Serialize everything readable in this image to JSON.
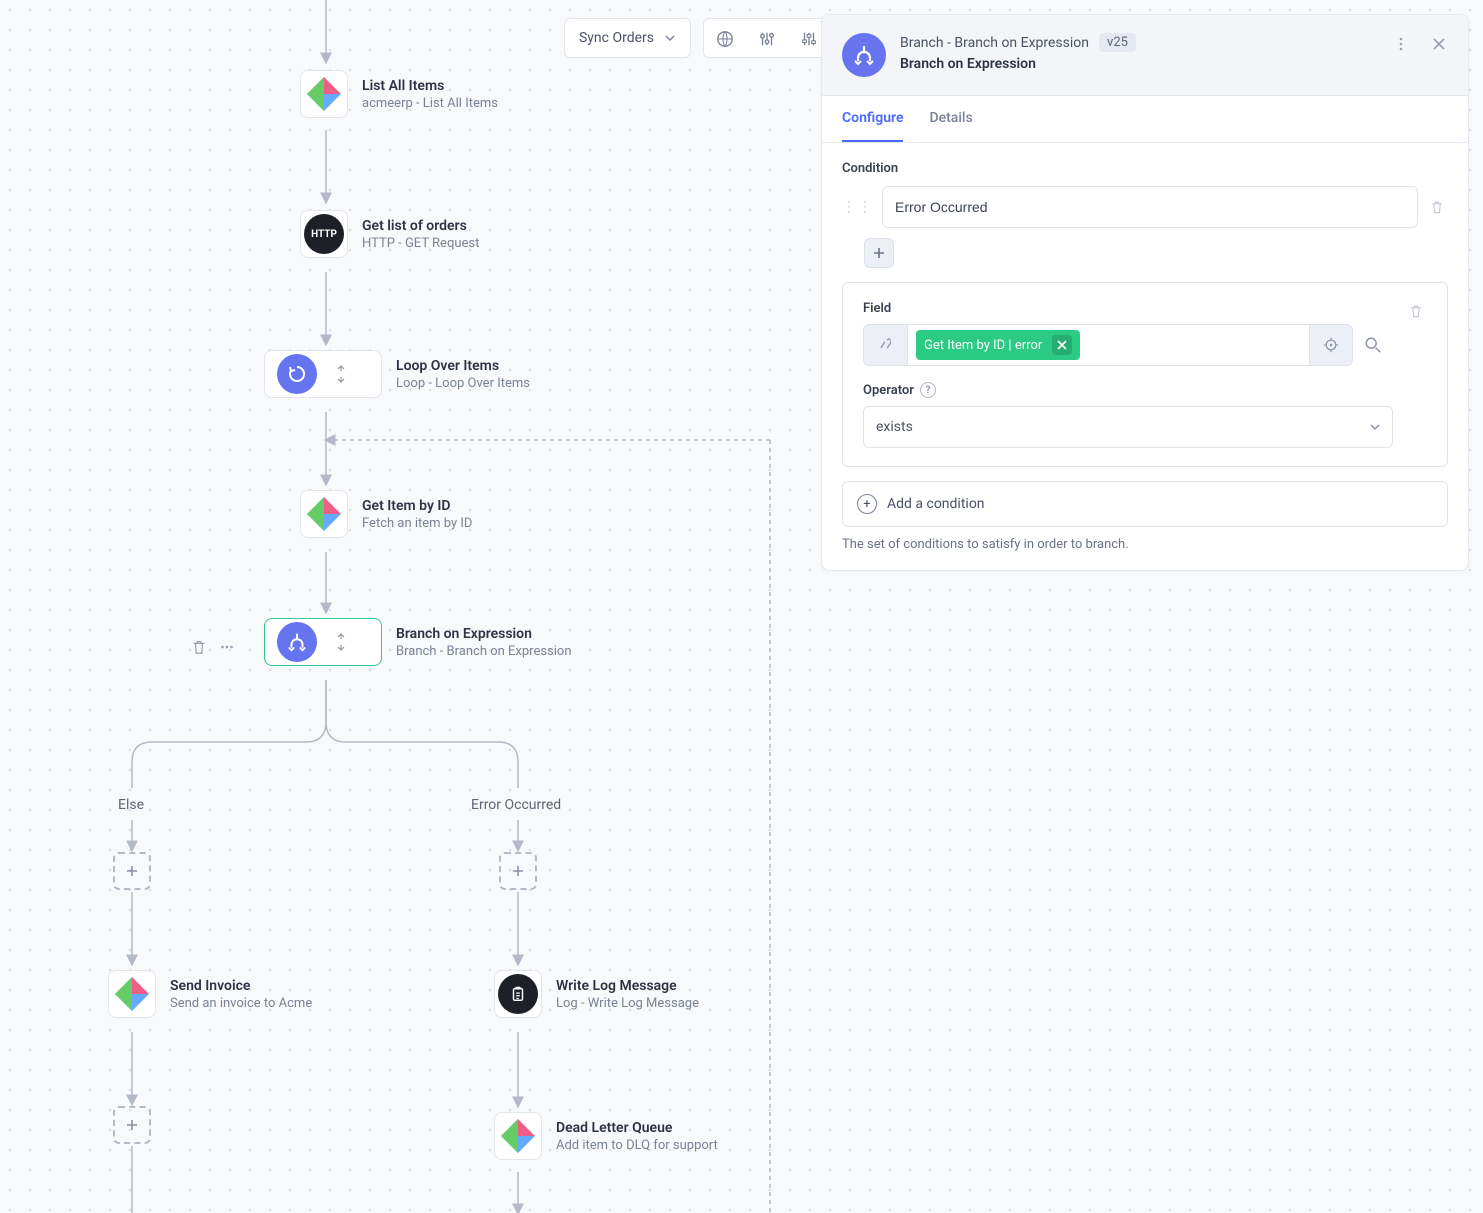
{
  "toolbar": {
    "workflow_name": "Sync Orders"
  },
  "nodes": {
    "list_items": {
      "title": "List All Items",
      "sub": "acmeerp - List All Items"
    },
    "get_orders": {
      "title": "Get list of orders",
      "sub": "HTTP - GET Request",
      "http_label": "HTTP"
    },
    "loop": {
      "title": "Loop Over Items",
      "sub": "Loop - Loop Over Items"
    },
    "get_item": {
      "title": "Get Item by ID",
      "sub": "Fetch an item by ID"
    },
    "branch": {
      "title": "Branch on Expression",
      "sub": "Branch - Branch on Expression"
    },
    "send_invoice": {
      "title": "Send Invoice",
      "sub": "Send an invoice to Acme"
    },
    "log": {
      "title": "Write Log Message",
      "sub": "Log - Write Log Message"
    },
    "dlq": {
      "title": "Dead Letter Queue",
      "sub": "Add item to DLQ for support"
    }
  },
  "branches": {
    "else": "Else",
    "error": "Error Occurred"
  },
  "panel": {
    "breadcrumb": "Branch - Branch on Expression",
    "version": "v25",
    "title": "Branch on Expression",
    "tabs": {
      "configure": "Configure",
      "details": "Details"
    },
    "condition_label": "Condition",
    "condition_value": "Error Occurred",
    "field_label": "Field",
    "chip": "Get Item by ID | error",
    "operator_label": "Operator",
    "operator_value": "exists",
    "add_condition": "Add a condition",
    "helptext": "The set of conditions to satisfy in order to branch."
  }
}
